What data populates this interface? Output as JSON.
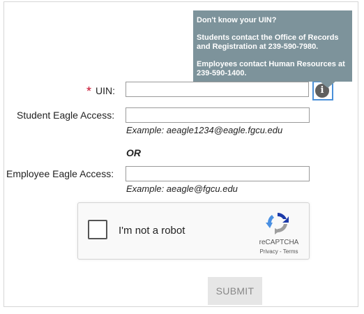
{
  "tooltip": {
    "title": "Don't know your UIN?",
    "students": "Students contact the Office of Records and Registration at 239-590-7980.",
    "employees": "Employees contact Human Resources at 239-590-1400."
  },
  "form": {
    "uin": {
      "required_marker": "*",
      "label": "UIN:",
      "value": ""
    },
    "student": {
      "label": "Student Eagle Access:",
      "value": "",
      "example": "Example: aeagle1234@eagle.fgcu.edu"
    },
    "or_text": "OR",
    "employee": {
      "label": "Employee Eagle Access:",
      "value": "",
      "example": "Example: aeagle@fgcu.edu"
    },
    "info_icon_glyph": "i"
  },
  "captcha": {
    "label": "I'm not a robot",
    "brand": "reCAPTCHA",
    "privacy": "Privacy",
    "separator": " - ",
    "terms": "Terms",
    "checked": false
  },
  "submit_label": "SUBMIT",
  "colors": {
    "tooltip_bg": "#7d939b",
    "required": "#c8102e",
    "info_border": "#4a90d9",
    "submit_bg": "#e6e6e6"
  },
  "icons": [
    "info-icon",
    "recaptcha-logo-icon"
  ]
}
